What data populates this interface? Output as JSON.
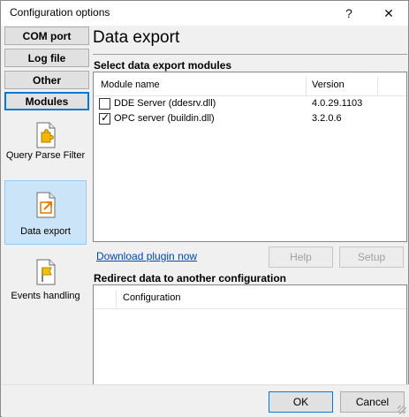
{
  "window": {
    "title": "Configuration options",
    "help_glyph": "?",
    "close_glyph": "✕"
  },
  "nav": {
    "buttons": [
      {
        "label": "COM port"
      },
      {
        "label": "Log file"
      },
      {
        "label": "Other"
      },
      {
        "label": "Modules",
        "active": true
      }
    ],
    "items": [
      {
        "label": "Query Parse Filter",
        "icon": "puzzle-document-icon"
      },
      {
        "label": "Data export",
        "icon": "export-document-icon",
        "selected": true
      },
      {
        "label": "Events handling",
        "icon": "flag-document-icon"
      }
    ]
  },
  "main": {
    "heading": "Data export",
    "modules_group": "Select data export modules",
    "columns": [
      "Module name",
      "Version"
    ],
    "modules": [
      {
        "name": "DDE Server (ddesrv.dll)",
        "version": "4.0.29.1103",
        "checked": false
      },
      {
        "name": "OPC server (buildin.dll)",
        "version": "3.2.0.6",
        "checked": true
      }
    ],
    "download_link": "Download plugin now",
    "help_button": "Help",
    "setup_button": "Setup",
    "redirect_group": "Redirect data to another configuration",
    "redirect_column": "Configuration"
  },
  "footer": {
    "ok": "OK",
    "cancel": "Cancel"
  },
  "colors": {
    "accent": "#0078d7",
    "selection": "#cce4f7",
    "link": "#0645ad"
  }
}
